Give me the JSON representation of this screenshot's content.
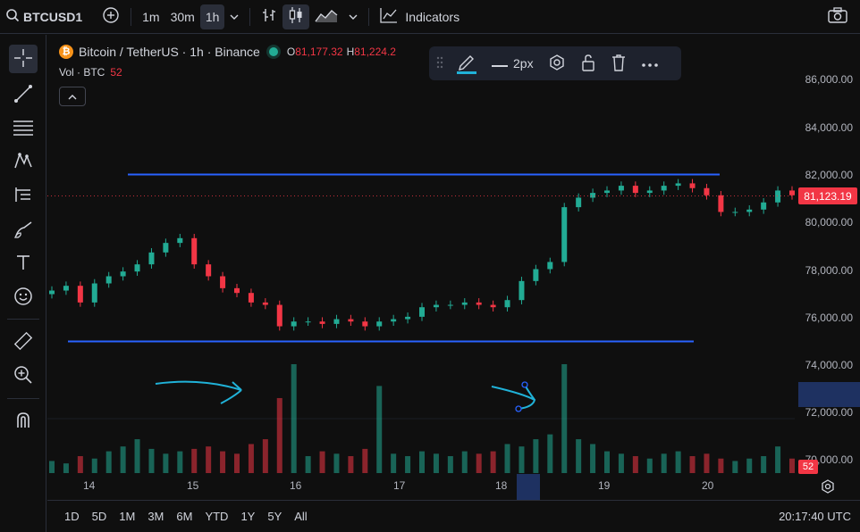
{
  "toolbar": {
    "symbol": "BTCUSD1",
    "intervals": [
      "1m",
      "30m",
      "1h"
    ],
    "active_interval": "1h",
    "indicators_label": "Indicators"
  },
  "legend": {
    "coin_glyph": "₿",
    "title": "Bitcoin / TetherUS · 1h · Binance",
    "open_label": "O",
    "open_value": "81,177.32",
    "high_label": "H",
    "high_value": "81,224.2",
    "volume_label": "Vol · BTC",
    "volume_value": "52"
  },
  "drawing_toolbar": {
    "line_width_label": "2px"
  },
  "price_axis": {
    "labels": [
      "86,000.00",
      "84,000.00",
      "82,000.00",
      "80,000.00",
      "78,000.00",
      "76,000.00",
      "74,000.00",
      "72,000.00",
      "70,000.00"
    ],
    "last_price": "81,123.19",
    "volume_tag": "52"
  },
  "time_axis": {
    "labels": [
      "14",
      "15",
      "16",
      "17",
      "18",
      "19",
      "20"
    ]
  },
  "bottom_bar": {
    "ranges": [
      "1D",
      "5D",
      "1M",
      "3M",
      "6M",
      "YTD",
      "1Y",
      "5Y",
      "All"
    ],
    "clock": "20:17:40 UTC"
  },
  "colors": {
    "up": "#22ab94",
    "down": "#f23645",
    "hline": "#2962ff",
    "annotation": "#20b2d8"
  },
  "chart_data": {
    "type": "candlestick",
    "x_labels": [
      "14",
      "15",
      "16",
      "17",
      "18",
      "19",
      "20"
    ],
    "ylim": [
      69500,
      87000
    ],
    "horizontal_lines": [
      82000,
      75000
    ],
    "last_price": 81123.19,
    "close_series_approx": [
      77100,
      77300,
      76600,
      77400,
      77700,
      77900,
      78200,
      78700,
      79100,
      79300,
      78200,
      77700,
      77200,
      77000,
      76600,
      76500,
      75600,
      75800,
      75800,
      75700,
      75900,
      75800,
      75600,
      75800,
      75900,
      76000,
      76400,
      76500,
      76500,
      76600,
      76500,
      76400,
      76700,
      77500,
      78000,
      78300,
      80600,
      81000,
      81200,
      81300,
      81500,
      81200,
      81300,
      81500,
      81600,
      81400,
      81100,
      80400,
      80400,
      80500,
      80800,
      81300,
      81100
    ],
    "volume_series_approx": [
      5,
      4,
      7,
      6,
      9,
      11,
      14,
      10,
      8,
      9,
      10,
      11,
      9,
      8,
      12,
      14,
      31,
      45,
      7,
      9,
      8,
      7,
      10,
      36,
      8,
      7,
      9,
      8,
      7,
      9,
      8,
      9,
      12,
      11,
      14,
      16,
      45,
      14,
      12,
      9,
      8,
      7,
      6,
      8,
      9,
      7,
      8,
      6,
      5,
      6,
      7,
      11,
      6
    ]
  }
}
